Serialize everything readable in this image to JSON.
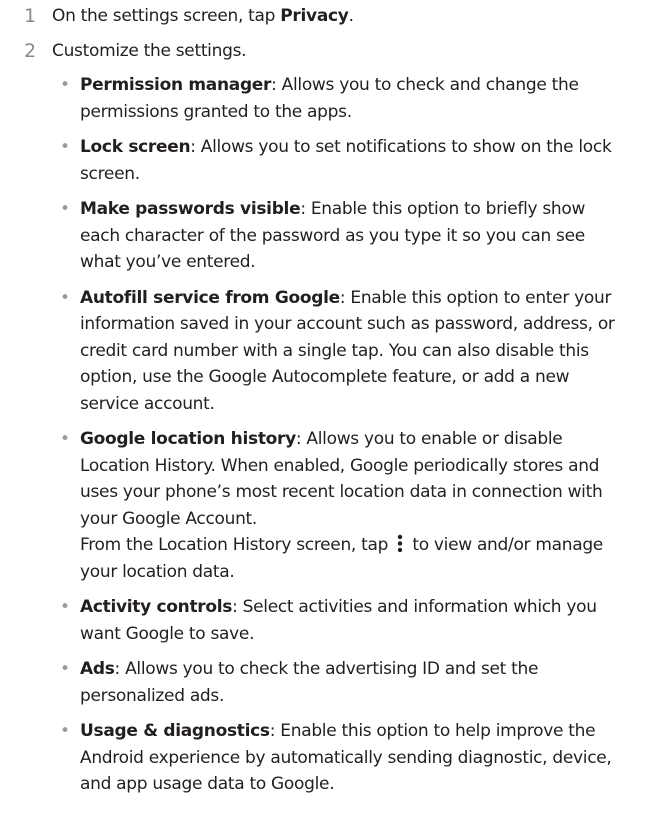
{
  "steps": [
    {
      "number": "1",
      "before": "On the settings screen, tap ",
      "bold": "Privacy",
      "after": "."
    },
    {
      "number": "2",
      "text": "Customize the settings."
    }
  ],
  "bullets": [
    {
      "title": "Permission manager",
      "text": ": Allows you to check and change the permissions granted to the apps."
    },
    {
      "title": "Lock screen",
      "text": ": Allows you to set notifications to show on the lock screen."
    },
    {
      "title": "Make passwords visible",
      "text": ": Enable this option to briefly show each character of the password as you type it so you can see what you’ve entered."
    },
    {
      "title": "Autofill service from Google",
      "text": ": Enable this option to enter your information saved in your account such as password, address, or credit card number with a single tap. You can also disable this option, use the Google Autocomplete feature, or add a new service account."
    },
    {
      "title": "Google location history",
      "text": ": Allows you to enable or disable Location History. When enabled, Google periodically stores and uses your phone’s most recent location data in connection with your Google Account.",
      "extra_before": "From the Location History screen, tap ",
      "extra_after": " to view and/or manage your location data.",
      "extra_icon": "more-vert-icon"
    },
    {
      "title": "Activity controls",
      "text": ": Select activities and information which you want Google to save."
    },
    {
      "title": "Ads",
      "text": ": Allows you to check the advertising ID and set the personalized ads."
    },
    {
      "title": "Usage & diagnostics",
      "text": ": Enable this option to help improve the Android experience by automatically sending diagnostic, device, and app usage data to Google."
    }
  ],
  "bullet_char": "•"
}
